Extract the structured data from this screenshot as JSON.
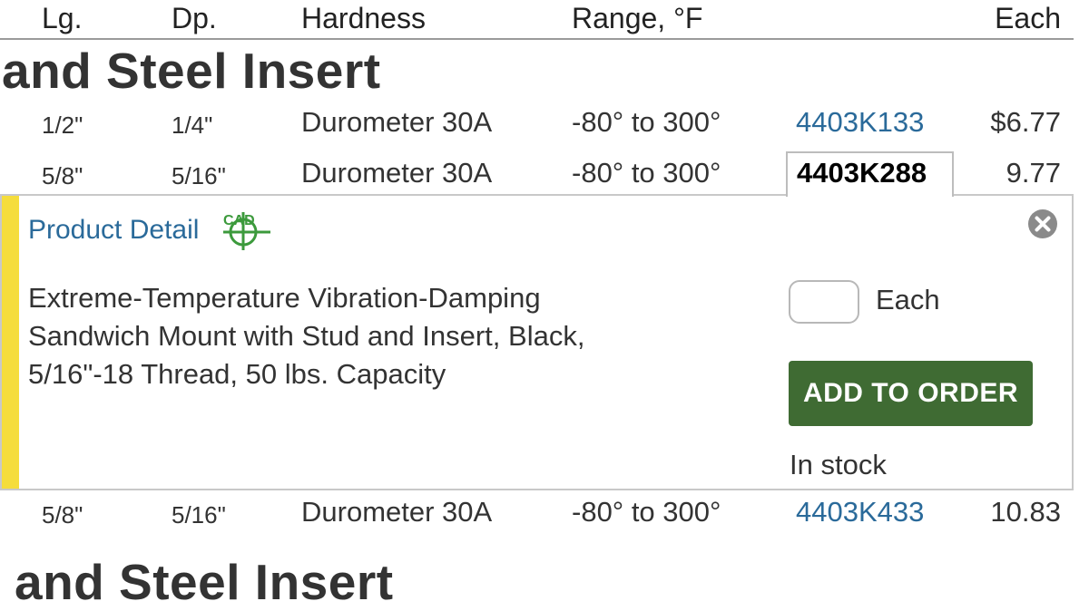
{
  "table_header": {
    "length": "Lg.",
    "depth": "Dp.",
    "hardness": "Hardness",
    "range": "Range, °F",
    "each": "Each"
  },
  "section_titles": [
    "and Steel Insert",
    "and Steel Insert"
  ],
  "rows": [
    {
      "lg": "1/2\"",
      "dp": "1/4\"",
      "hardness": "Durometer 30A",
      "range": "-80° to 300°",
      "part": "4403K133",
      "price": "$6.77"
    },
    {
      "lg": "5/8\"",
      "dp": "5/16\"",
      "hardness": "Durometer 30A",
      "range": "-80° to 300°",
      "part": "4403K288",
      "price": "9.77",
      "selected": true
    },
    {
      "lg": "5/8\"",
      "dp": "5/16\"",
      "hardness": "Durometer 30A",
      "range": "-80° to 300°",
      "part": "4403K433",
      "price": "10.83"
    }
  ],
  "product_detail": {
    "link_label": "Product Detail",
    "cad_icon": "cad-crosshair-icon",
    "cad_label": "CAD",
    "close_icon": "close-circle-icon",
    "description_lines": [
      "Extreme-Temperature Vibration-Damping",
      "Sandwich Mount with Stud and Insert, Black,",
      "5/16\"-18 Thread, 50 lbs. Capacity"
    ],
    "quantity_value": "",
    "quantity_unit": "Each",
    "add_button_label": "ADD TO ORDER",
    "stock_status": "In stock"
  },
  "colors": {
    "link_blue": "#2a6a9a",
    "button_green": "#3f6b33",
    "cad_green": "#3c9a3c",
    "highlight_yellow": "#f5dd3c"
  }
}
